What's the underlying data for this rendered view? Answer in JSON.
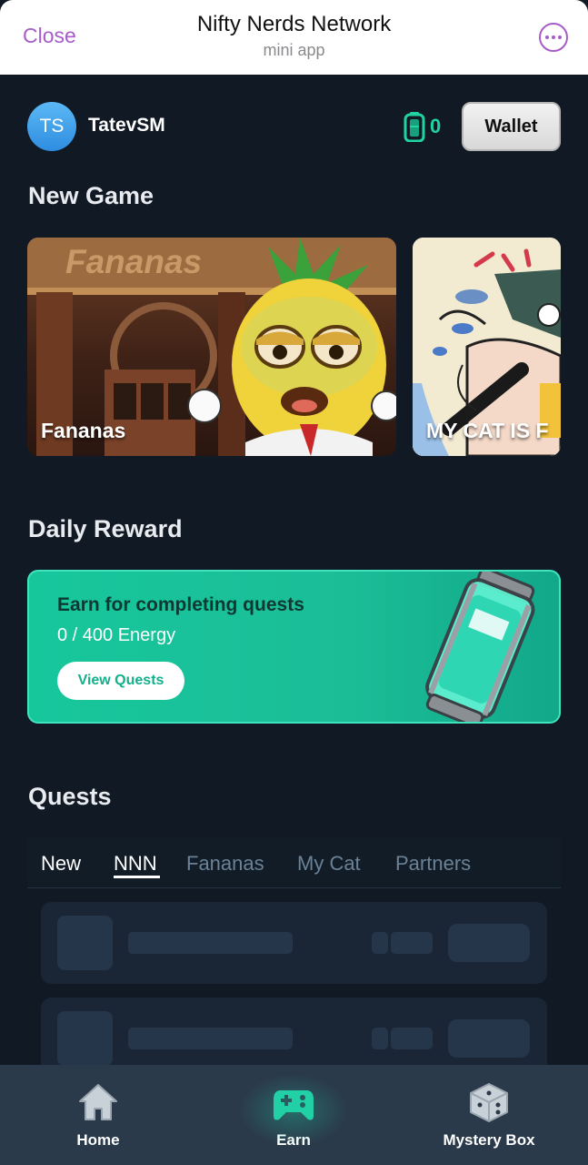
{
  "header": {
    "close_label": "Close",
    "title": "Nifty Nerds Network",
    "subtitle": "mini app"
  },
  "profile": {
    "avatar_initials": "TS",
    "username": "TatevSM",
    "energy_count": "0",
    "wallet_label": "Wallet"
  },
  "new_game": {
    "title": "New Game",
    "cards": [
      {
        "label": "Fananas",
        "sign": "Fananas"
      },
      {
        "label": "MY CAT IS F"
      }
    ]
  },
  "daily_reward": {
    "title": "Daily Reward",
    "card_title": "Earn for completing quests",
    "progress_text": "0 / 400 Energy",
    "button_label": "View Quests"
  },
  "quests": {
    "title": "Quests",
    "tabs": [
      "New",
      "NNN",
      "Fananas",
      "My Cat",
      "Partners"
    ],
    "active_tab": "NNN"
  },
  "bottom_nav": {
    "items": [
      {
        "label": "Home",
        "icon": "home-icon"
      },
      {
        "label": "Earn",
        "icon": "gamepad-icon"
      },
      {
        "label": "Mystery Box",
        "icon": "dice-box-icon"
      }
    ]
  },
  "colors": {
    "accent": "#20d4a2",
    "telegram_accent": "#a65cc9",
    "background": "#111a24"
  }
}
